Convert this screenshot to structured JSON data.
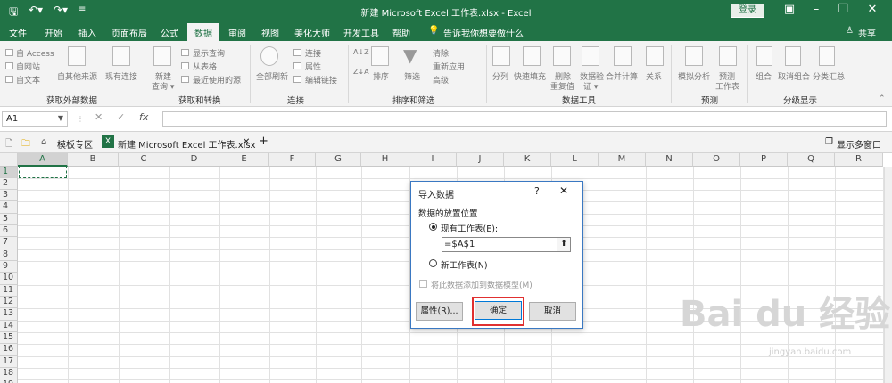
{
  "titlebar": {
    "title": "新建 Microsoft Excel 工作表.xlsx  -  Excel",
    "login": "登录",
    "quick_access": [
      "save-icon",
      "undo-icon",
      "redo-icon",
      "customize-icon"
    ]
  },
  "tabs": [
    "文件",
    "开始",
    "插入",
    "页面布局",
    "公式",
    "数据",
    "审阅",
    "视图",
    "美化大师",
    "开发工具",
    "帮助"
  ],
  "active_tab": "数据",
  "tell_me": "告诉我你想要做什么",
  "share": "共享",
  "ribbon": {
    "get_external": {
      "access": "自 Access",
      "web": "自网站",
      "text": "自文本",
      "other": "自其他来源",
      "existing": "现有连接",
      "label": "获取外部数据"
    },
    "get_transform": {
      "new_query": "新建",
      "new_query2": "查询 ▾",
      "show_queries": "显示查询",
      "from_table": "从表格",
      "recent": "最近使用的源",
      "label": "获取和转换"
    },
    "connections": {
      "refresh_all": "全部刷新",
      "connections": "连接",
      "properties": "属性",
      "edit_links": "编辑链接",
      "label": "连接"
    },
    "sort_filter": {
      "sort": "排序",
      "filter": "筛选",
      "clear": "清除",
      "reapply": "重新应用",
      "advanced": "高级",
      "label": "排序和筛选"
    },
    "data_tools": {
      "split": "分列",
      "flash": "快速填充",
      "remove_dup": "删除",
      "remove_dup2": "重复值",
      "validate": "数据验",
      "validate2": "证 ▾",
      "consolidate": "合并计算",
      "relations": "关系",
      "label": "数据工具"
    },
    "forecast": {
      "whatif": "模拟分析",
      "sheet": "预测",
      "sheet2": "工作表",
      "label": "预测"
    },
    "outline": {
      "group": "组合",
      "ungroup": "取消组合",
      "subtotal": "分类汇总",
      "label": "分级显示"
    }
  },
  "formula_bar": {
    "name_box": "A1",
    "fx": "fx",
    "value": ""
  },
  "workbook_tabs": {
    "template": "模板专区",
    "file": "新建 Microsoft Excel 工作表.xlsx",
    "multi_window": "显示多窗口"
  },
  "columns": [
    "A",
    "B",
    "C",
    "D",
    "E",
    "F",
    "G",
    "H",
    "I",
    "J",
    "K",
    "L",
    "M",
    "N",
    "O",
    "P",
    "Q",
    "R"
  ],
  "rows": [
    "1",
    "2",
    "3",
    "4",
    "5",
    "6",
    "7",
    "8",
    "9",
    "10",
    "11",
    "12",
    "13",
    "14",
    "15",
    "16",
    "17",
    "18",
    "19"
  ],
  "dialog": {
    "title": "导入数据",
    "help": "?",
    "close": "✕",
    "section": "数据的放置位置",
    "existing_sheet": "现有工作表(E):",
    "ref": "=$A$1",
    "new_sheet": "新工作表(N)",
    "add_model": "将此数据添加到数据模型(M)",
    "properties": "属性(R)...",
    "ok": "确定",
    "cancel": "取消"
  },
  "watermark": {
    "logo": "Bai du 经验",
    "url": "jingyan.baidu.com"
  }
}
